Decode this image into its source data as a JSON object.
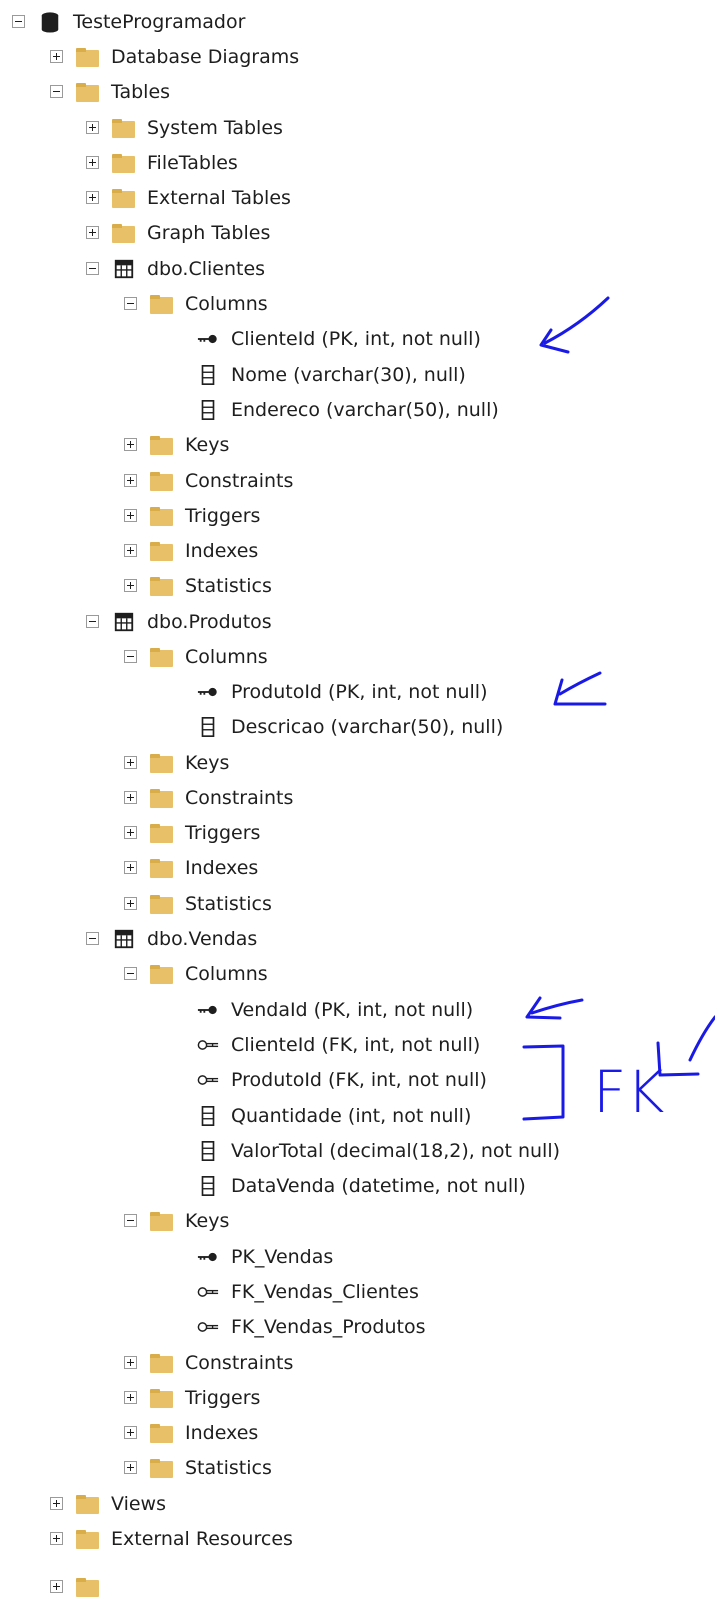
{
  "tree": {
    "root": "TesteProgramador",
    "database_diagrams": "Database Diagrams",
    "tables": "Tables",
    "system_tables": "System Tables",
    "file_tables": "FileTables",
    "external_tables": "External Tables",
    "graph_tables": "Graph Tables",
    "clientes": {
      "name": "dbo.Clientes",
      "columns": "Columns",
      "col1": "ClienteId (PK, int, not null)",
      "col2": "Nome (varchar(30), null)",
      "col3": "Endereco (varchar(50), null)",
      "keys": "Keys",
      "constraints": "Constraints",
      "triggers": "Triggers",
      "indexes": "Indexes",
      "statistics": "Statistics"
    },
    "produtos": {
      "name": "dbo.Produtos",
      "columns": "Columns",
      "col1": "ProdutoId (PK, int, not null)",
      "col2": "Descricao (varchar(50), null)",
      "keys": "Keys",
      "constraints": "Constraints",
      "triggers": "Triggers",
      "indexes": "Indexes",
      "statistics": "Statistics"
    },
    "vendas": {
      "name": "dbo.Vendas",
      "columns": "Columns",
      "col1": "VendaId (PK, int, not null)",
      "col2": "ClienteId (FK, int, not null)",
      "col3": "ProdutoId (FK, int, not null)",
      "col4": "Quantidade (int, not null)",
      "col5": "ValorTotal (decimal(18,2), not null)",
      "col6": "DataVenda (datetime, not null)",
      "keys": "Keys",
      "key1": "PK_Vendas",
      "key2": "FK_Vendas_Clientes",
      "key3": "FK_Vendas_Produtos",
      "constraints": "Constraints",
      "triggers": "Triggers",
      "indexes": "Indexes",
      "statistics": "Statistics"
    },
    "views": "Views",
    "external_resources": "External Resources"
  },
  "annotation": {
    "color": "#1a1ae6",
    "handwritten_text": "FK"
  },
  "colors": {
    "folder": "#e7c068",
    "expander_border": "#9a9a9a"
  }
}
